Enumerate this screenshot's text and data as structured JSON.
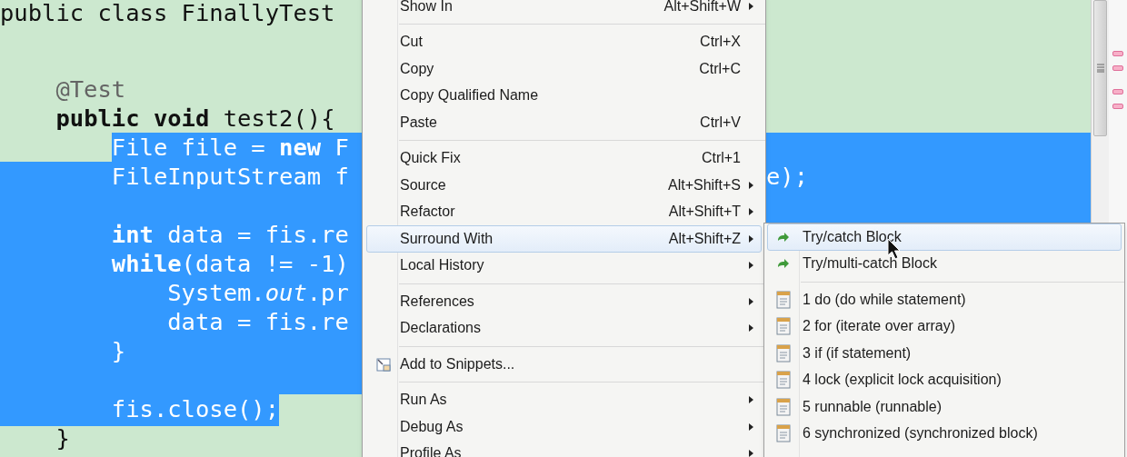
{
  "editor": {
    "lines": [
      {
        "kind": "code",
        "text": "public class FinallyTest",
        "selected": false
      },
      {
        "kind": "blank",
        "selected": false
      },
      {
        "kind": "blank",
        "selected": false
      },
      {
        "kind": "annotation",
        "text": "    @Test",
        "selected": false
      },
      {
        "kind": "code",
        "text": "    **public** **void** test2(){",
        "selected": false
      },
      {
        "kind": "code",
        "text": "        File file = **new** F",
        "selected": true,
        "starts_after_indent": true,
        "ends_at_text": false
      },
      {
        "kind": "code",
        "text": "        FileInputStream f",
        "right_text": "e);",
        "selected": true,
        "starts_after_indent": false,
        "ends_at_text": false
      },
      {
        "kind": "blank",
        "selected": true,
        "starts_after_indent": false,
        "ends_at_text": false
      },
      {
        "kind": "code",
        "text": "        **int** data = fis.re",
        "selected": true,
        "starts_after_indent": false,
        "ends_at_text": false
      },
      {
        "kind": "code",
        "text": "        **while**(data != -1)",
        "selected": true,
        "starts_after_indent": false,
        "ends_at_text": false
      },
      {
        "kind": "code",
        "text": "            System.*out*.pr",
        "selected": true,
        "starts_after_indent": false,
        "ends_at_text": false
      },
      {
        "kind": "code",
        "text": "            data = fis.re",
        "selected": true,
        "starts_after_indent": false,
        "ends_at_text": false
      },
      {
        "kind": "code",
        "text": "        }",
        "selected": true,
        "starts_after_indent": false,
        "ends_at_text": false
      },
      {
        "kind": "blank",
        "selected": true,
        "starts_after_indent": false,
        "ends_at_text": false
      },
      {
        "kind": "code",
        "text": "        fis.close();",
        "selected": true,
        "starts_after_indent": false,
        "ends_at_text": true
      },
      {
        "kind": "code",
        "text": "    }",
        "selected": false
      }
    ]
  },
  "context_menu": {
    "items": [
      {
        "kind": "item",
        "label": "Show In",
        "shortcut": "Alt+Shift+W",
        "submenu": true,
        "selected": false
      },
      {
        "kind": "separator"
      },
      {
        "kind": "item",
        "label": "Cut",
        "shortcut": "Ctrl+X",
        "submenu": false,
        "selected": false
      },
      {
        "kind": "item",
        "label": "Copy",
        "shortcut": "Ctrl+C",
        "submenu": false,
        "selected": false
      },
      {
        "kind": "item",
        "label": "Copy Qualified Name",
        "submenu": false,
        "selected": false
      },
      {
        "kind": "item",
        "label": "Paste",
        "shortcut": "Ctrl+V",
        "submenu": false,
        "selected": false
      },
      {
        "kind": "separator"
      },
      {
        "kind": "item",
        "label": "Quick Fix",
        "shortcut": "Ctrl+1",
        "submenu": false,
        "selected": false
      },
      {
        "kind": "item",
        "label": "Source",
        "shortcut": "Alt+Shift+S",
        "submenu": true,
        "selected": false
      },
      {
        "kind": "item",
        "label": "Refactor",
        "shortcut": "Alt+Shift+T",
        "submenu": true,
        "selected": false
      },
      {
        "kind": "item",
        "label": "Surround With",
        "shortcut": "Alt+Shift+Z",
        "submenu": true,
        "selected": true
      },
      {
        "kind": "item",
        "label": "Local History",
        "submenu": true,
        "selected": false
      },
      {
        "kind": "separator"
      },
      {
        "kind": "item",
        "label": "References",
        "submenu": true,
        "selected": false
      },
      {
        "kind": "item",
        "label": "Declarations",
        "submenu": true,
        "selected": false
      },
      {
        "kind": "separator"
      },
      {
        "kind": "icon_item",
        "label": "Add to Snippets...",
        "submenu": false,
        "selected": false
      },
      {
        "kind": "separator"
      },
      {
        "kind": "item",
        "label": "Run As",
        "submenu": true,
        "selected": false
      },
      {
        "kind": "item",
        "label": "Debug As",
        "submenu": true,
        "selected": false
      },
      {
        "kind": "item",
        "label": "Profile As",
        "submenu": true,
        "selected": false
      }
    ]
  },
  "submenu": {
    "items": [
      {
        "kind": "quick_assist",
        "label": "Try/catch Block",
        "selected": true
      },
      {
        "kind": "quick_assist",
        "label": "Try/multi-catch Block",
        "selected": false
      },
      {
        "kind": "separator"
      },
      {
        "kind": "template",
        "label": "1 do (do while statement)",
        "selected": false
      },
      {
        "kind": "template",
        "label": "2 for (iterate over array)",
        "selected": false
      },
      {
        "kind": "template",
        "label": "3 if (if statement)",
        "selected": false
      },
      {
        "kind": "template",
        "label": "4 lock (explicit lock acquisition)",
        "selected": false
      },
      {
        "kind": "template",
        "label": "5 runnable (runnable)",
        "selected": false
      },
      {
        "kind": "template",
        "label": "6 synchronized (synchronized block)",
        "selected": false
      }
    ]
  }
}
